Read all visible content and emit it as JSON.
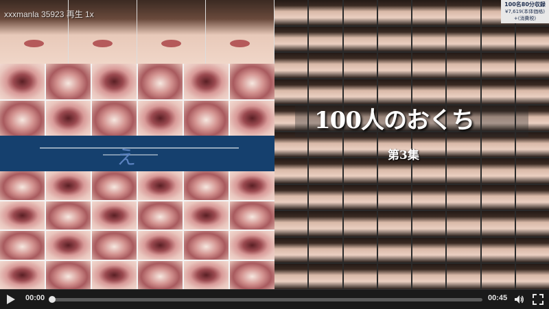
{
  "overlay": {
    "watermark": "xxxmanla 35923 再生 1x"
  },
  "cover": {
    "title": "100人のおくち",
    "subtitle": "第3集",
    "badge_main": "100名80分収録",
    "badge_sub": "¥7,619(本体価格)",
    "badge_sub2": "+(消費税)"
  },
  "player": {
    "current_time": "00:00",
    "duration": "00:45",
    "progress": 0,
    "icons": {
      "play": "play-icon",
      "volume": "volume-icon",
      "fullscreen": "fullscreen-icon"
    }
  }
}
